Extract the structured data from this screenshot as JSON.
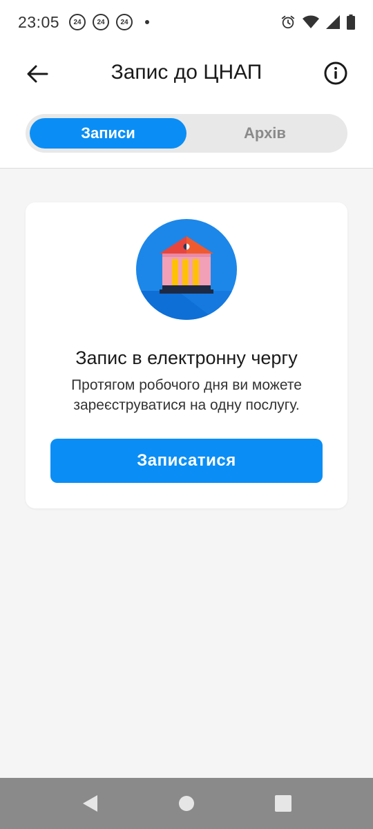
{
  "status_bar": {
    "time": "23:05",
    "badges": [
      "24",
      "24",
      "24"
    ]
  },
  "header": {
    "title": "Запис до ЦНАП",
    "back_icon": "arrow-left-icon",
    "info_icon": "info-icon"
  },
  "tabs": [
    {
      "label": "Записи",
      "active": true
    },
    {
      "label": "Архів",
      "active": false
    }
  ],
  "card": {
    "illustration_icon": "government-building-icon",
    "title": "Запис в електронну чергу",
    "description": "Протягом робочого дня ви можете зареєструватися на одну послугу.",
    "button_label": "Записатися"
  },
  "colors": {
    "accent": "#0a8ef5",
    "background": "#f5f5f5",
    "card": "#ffffff"
  }
}
